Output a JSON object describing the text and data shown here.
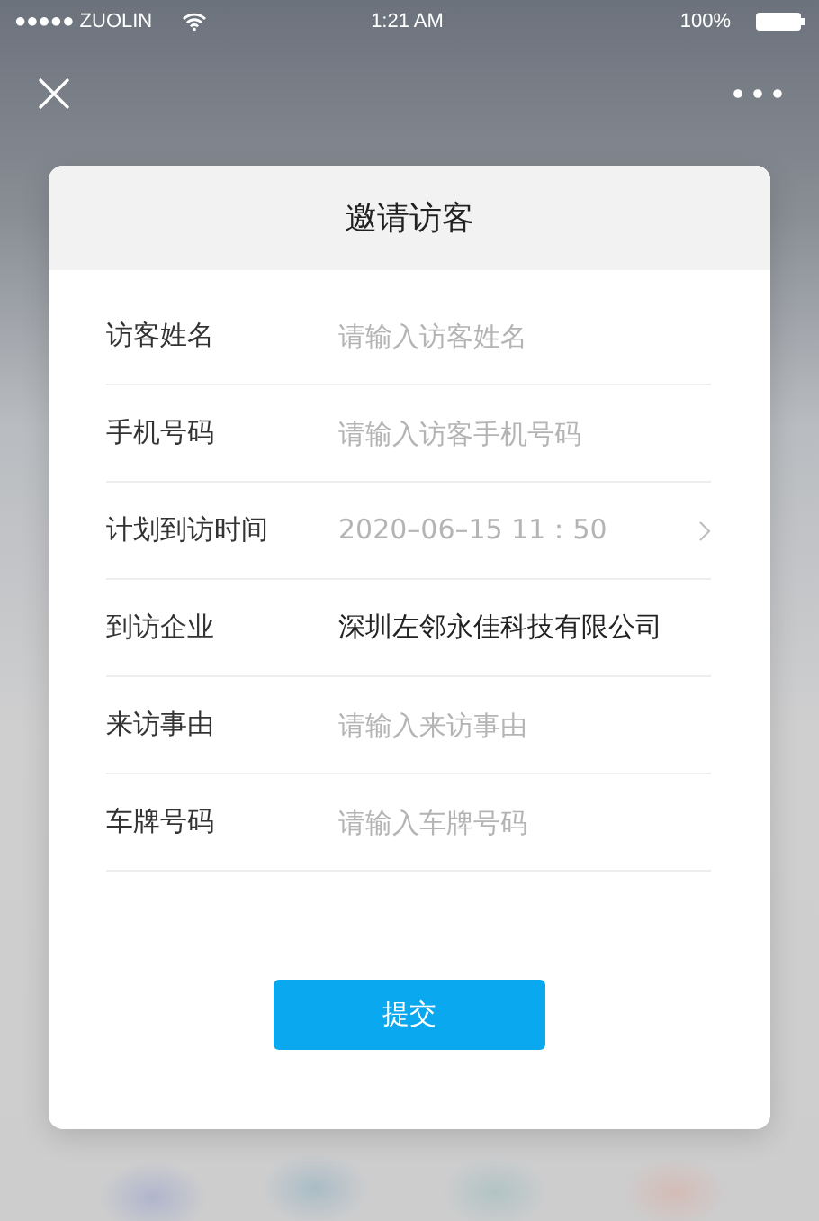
{
  "status_bar": {
    "carrier": "●●●●● ZUOLIN",
    "time": "1:21 AM",
    "battery": "100%"
  },
  "dialog": {
    "title": "邀请访客",
    "fields": [
      {
        "kind": "input",
        "label": "访客姓名",
        "placeholder": "请输入访客姓名"
      },
      {
        "kind": "input",
        "label": "手机号码",
        "placeholder": "请输入访客手机号码"
      },
      {
        "kind": "picker",
        "label": "计划到访时间",
        "value": "2020–06–15 11：50"
      },
      {
        "kind": "static",
        "label": "到访企业",
        "value": "深圳左邻永佳科技有限公司"
      },
      {
        "kind": "input",
        "label": "来访事由",
        "placeholder": "请输入来访事由"
      },
      {
        "kind": "input",
        "label": "车牌号码",
        "placeholder": "请输入车牌号码"
      }
    ],
    "submit": "提交"
  }
}
